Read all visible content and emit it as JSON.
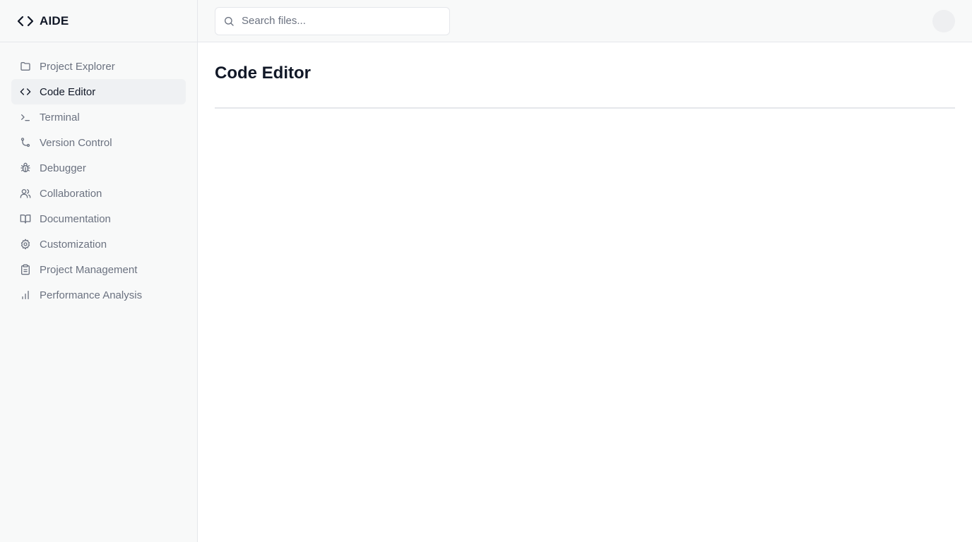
{
  "app": {
    "name": "AIDE"
  },
  "sidebar": {
    "items": [
      {
        "label": "Project Explorer",
        "icon": "folder-icon",
        "active": false
      },
      {
        "label": "Code Editor",
        "icon": "code-icon",
        "active": true
      },
      {
        "label": "Terminal",
        "icon": "terminal-icon",
        "active": false
      },
      {
        "label": "Version Control",
        "icon": "git-branch-icon",
        "active": false
      },
      {
        "label": "Debugger",
        "icon": "bug-icon",
        "active": false
      },
      {
        "label": "Collaboration",
        "icon": "users-icon",
        "active": false
      },
      {
        "label": "Documentation",
        "icon": "book-icon",
        "active": false
      },
      {
        "label": "Customization",
        "icon": "gear-icon",
        "active": false
      },
      {
        "label": "Project Management",
        "icon": "clipboard-icon",
        "active": false
      },
      {
        "label": "Performance Analysis",
        "icon": "bar-chart-icon",
        "active": false
      }
    ]
  },
  "header": {
    "search_placeholder": "Search files...",
    "search_value": ""
  },
  "main": {
    "title": "Code Editor"
  },
  "colors": {
    "sidebar_bg": "#f8f9f9",
    "active_item_bg": "#eff1f3",
    "text_primary": "#111827",
    "text_muted": "#6b7280",
    "border": "#e5e7eb"
  }
}
